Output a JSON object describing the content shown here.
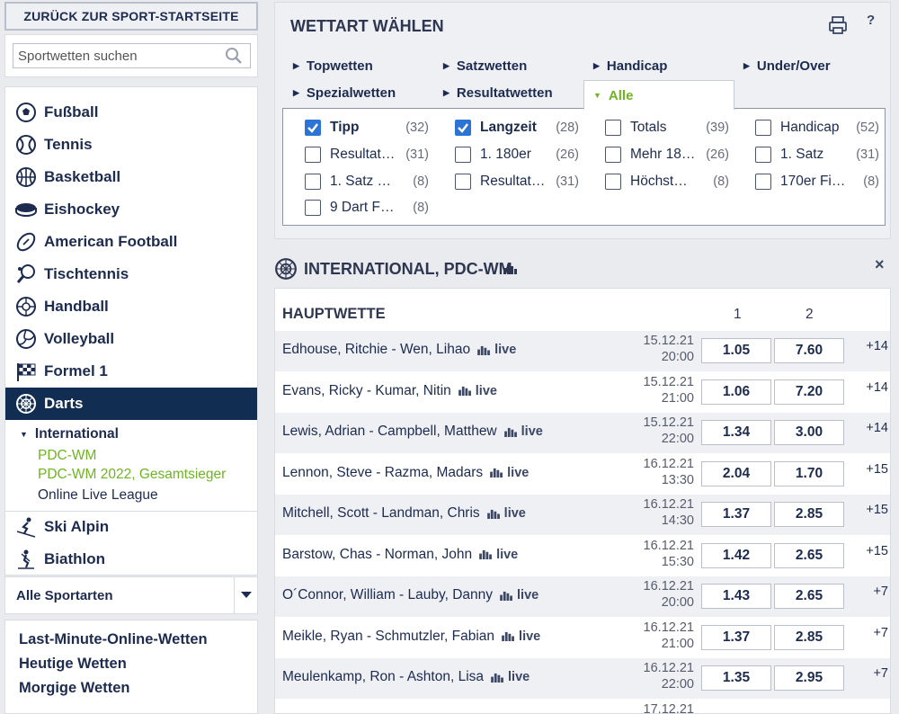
{
  "sidebar": {
    "back_label": "ZURÜCK ZUR SPORT-STARTSEITE",
    "search_placeholder": "Sportwetten suchen",
    "sports": [
      {
        "label": "Fußball",
        "icon": "soccer-ball-icon"
      },
      {
        "label": "Tennis",
        "icon": "tennis-ball-icon"
      },
      {
        "label": "Basketball",
        "icon": "basketball-icon"
      },
      {
        "label": "Eishockey",
        "icon": "hockey-puck-icon"
      },
      {
        "label": "American Football",
        "icon": "american-football-icon"
      },
      {
        "label": "Tischtennis",
        "icon": "table-tennis-icon"
      },
      {
        "label": "Handball",
        "icon": "handball-icon"
      },
      {
        "label": "Volleyball",
        "icon": "volleyball-icon"
      },
      {
        "label": "Formel 1",
        "icon": "checkered-flag-icon"
      },
      {
        "label": "Darts",
        "icon": "dartboard-icon",
        "active": true
      },
      {
        "label": "Ski Alpin",
        "icon": "skier-icon"
      },
      {
        "label": "Biathlon",
        "icon": "biathlon-icon"
      }
    ],
    "darts_sub": {
      "group": "International",
      "items": [
        {
          "label": "PDC-WM",
          "highlight": true
        },
        {
          "label": "PDC-WM 2022, Gesamtsieger",
          "highlight": true
        },
        {
          "label": "Online Live League",
          "highlight": false
        }
      ]
    },
    "all_sports": "Alle Sportarten",
    "quick_links": [
      "Last-Minute-Online-Wetten",
      "Heutige Wetten",
      "Morgige Wetten"
    ]
  },
  "bettype": {
    "title": "WETTART WÄHLEN",
    "tabs": [
      "Topwetten",
      "Satzwetten",
      "Handicap",
      "Under/Over",
      "Spezialwetten",
      "Resultatwetten",
      "Alle"
    ],
    "active_tab": "Alle",
    "markets": [
      {
        "name": "Tipp",
        "count": "(32)",
        "checked": true
      },
      {
        "name": "Langzeit",
        "count": "(28)",
        "checked": true
      },
      {
        "name": "Totals",
        "count": "(39)",
        "checked": false
      },
      {
        "name": "Handicap",
        "count": "(52)",
        "checked": false
      },
      {
        "name": "Resultat…",
        "count": "(31)",
        "checked": false
      },
      {
        "name": "1. 180er",
        "count": "(26)",
        "checked": false
      },
      {
        "name": "Mehr 18…",
        "count": "(26)",
        "checked": false
      },
      {
        "name": "1. Satz",
        "count": "(31)",
        "checked": false
      },
      {
        "name": "1. Satz …",
        "count": "(8)",
        "checked": false
      },
      {
        "name": "Resultat…",
        "count": "(31)",
        "checked": false
      },
      {
        "name": "Höchst…",
        "count": "(8)",
        "checked": false
      },
      {
        "name": "170er Fi…",
        "count": "(8)",
        "checked": false
      },
      {
        "name": "9 Dart F…",
        "count": "(8)",
        "checked": false
      }
    ]
  },
  "event": {
    "title": "INTERNATIONAL, PDC-WM",
    "market_title": "HAUPTWETTE",
    "col1": "1",
    "col2": "2",
    "live_label": "live",
    "matches": [
      {
        "name": "Edhouse, Ritchie - Wen, Lihao",
        "date": "15.12.21",
        "time": "20:00",
        "odd1": "1.05",
        "odd2": "7.60",
        "more": "+14"
      },
      {
        "name": "Evans, Ricky - Kumar, Nitin",
        "date": "15.12.21",
        "time": "21:00",
        "odd1": "1.06",
        "odd2": "7.20",
        "more": "+14"
      },
      {
        "name": "Lewis, Adrian - Campbell, Matthew",
        "date": "15.12.21",
        "time": "22:00",
        "odd1": "1.34",
        "odd2": "3.00",
        "more": "+14"
      },
      {
        "name": "Lennon, Steve - Razma, Madars",
        "date": "16.12.21",
        "time": "13:30",
        "odd1": "2.04",
        "odd2": "1.70",
        "more": "+15"
      },
      {
        "name": "Mitchell, Scott - Landman, Chris",
        "date": "16.12.21",
        "time": "14:30",
        "odd1": "1.37",
        "odd2": "2.85",
        "more": "+15"
      },
      {
        "name": "Barstow, Chas - Norman, John",
        "date": "16.12.21",
        "time": "15:30",
        "odd1": "1.42",
        "odd2": "2.65",
        "more": "+15"
      },
      {
        "name": "O´Connor, William - Lauby, Danny",
        "date": "16.12.21",
        "time": "20:00",
        "odd1": "1.43",
        "odd2": "2.65",
        "more": "+7"
      },
      {
        "name": "Meikle, Ryan - Schmutzler, Fabian",
        "date": "16.12.21",
        "time": "21:00",
        "odd1": "1.37",
        "odd2": "2.85",
        "more": "+7"
      },
      {
        "name": "Meulenkamp, Ron - Ashton, Lisa",
        "date": "16.12.21",
        "time": "22:00",
        "odd1": "1.35",
        "odd2": "2.95",
        "more": "+7"
      },
      {
        "name": "",
        "date": "17.12.21",
        "time": "",
        "odd1": "",
        "odd2": "",
        "more": ""
      }
    ]
  },
  "colors": {
    "navy": "#112d52",
    "accent_green": "#6fb521",
    "checkbox_blue": "#2b74d6",
    "background": "#e9ebef"
  }
}
